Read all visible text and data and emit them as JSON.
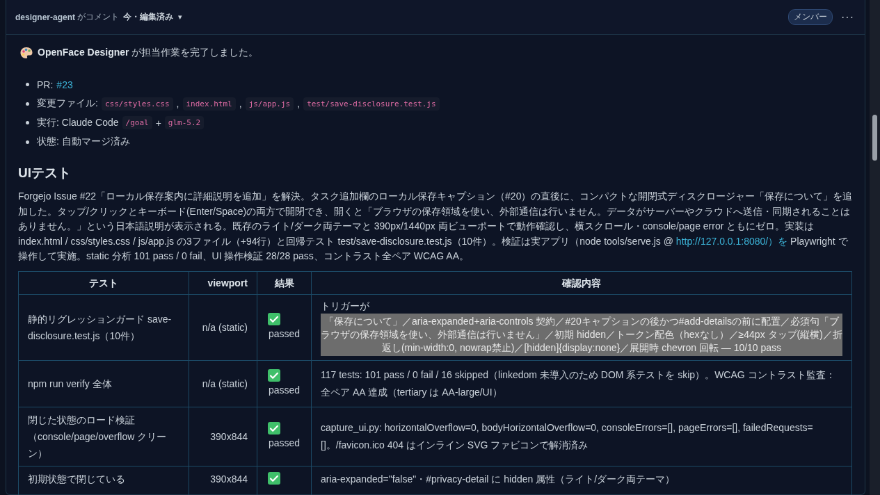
{
  "comment_header": {
    "author": "designer-agent",
    "action": "がコメント",
    "time": "今・編集済み",
    "caret": "▾",
    "badge": "メンバー",
    "more": "···"
  },
  "intro": "**OpenFace Designer** が担当作業を完了しました。",
  "summary": [
    {
      "label": "PR:",
      "parts": [
        {
          "kind": "link",
          "text": "#23"
        }
      ]
    },
    {
      "label": "変更ファイル:",
      "parts": [
        {
          "kind": "code",
          "text": "css/styles.css"
        },
        {
          "kind": "text",
          "text": ","
        },
        {
          "kind": "code",
          "text": "index.html"
        },
        {
          "kind": "text",
          "text": ","
        },
        {
          "kind": "code",
          "text": "js/app.js"
        },
        {
          "kind": "text",
          "text": ","
        },
        {
          "kind": "code",
          "text": "test/save-disclosure.test.js"
        }
      ]
    },
    {
      "label": "実行: Claude Code",
      "parts": [
        {
          "kind": "code",
          "text": "/goal"
        },
        {
          "kind": "text",
          "text": "+"
        },
        {
          "kind": "code",
          "text": "glm-5.2"
        }
      ]
    },
    {
      "label": "状態: 自動マージ済み"
    }
  ],
  "heading": "UIテスト",
  "paragraph": {
    "before": "Forgejo Issue #22「ローカル保存案内に詳細説明を追加」を解決。タスク追加欄のローカル保存キャプション（#20）の直後に、コンパクトな開閉式ディスクロージャー「保存について」を追加した。タップ/クリックとキーボード(Enter/Space)の両方で開閉でき、開くと「ブラウザの保存領域を使い、外部通信は行いません。データがサーバーやクラウドへ送信・同期されることはありません。」という日本語説明が表示される。既存のライト/ダーク両テーマと 390px/1440px 両ビューポートで動作確認し、横スクロール・console/page error ともにゼロ。実装は index.html / css/styles.css / js/app.js の3ファイル（+94行）と回帰テスト test/save-disclosure.test.js（10件）。検証は実アプリ（node tools/serve.js @ ",
    "link": "http://127.0.0.1:8080/）を",
    "after": " Playwright で操作して実施。static 分析 101 pass / 0 fail、UI 操作検証 28/28 pass、コントラスト全ペア WCAG AA。"
  },
  "table": {
    "columns": [
      "テスト",
      "viewport",
      "結果",
      "確認内容"
    ],
    "rows": [
      {
        "test": "静的リグレッションガード save-disclosure.test.js（10件）",
        "viewport": "n/a (static)",
        "result": {
          "ok": true,
          "label": "passed"
        },
        "detail": {
          "kind": "highlight",
          "lead": "トリガーが",
          "text": "「保存について」／aria-expanded+aria-controls 契約／#20キャプションの後かつ#add-detailsの前に配置／必須句「ブラウザの保存領域を使い、外部通信は行いません」／初期 hidden／トークン配色（hexなし）／≥44px タップ(縦横)／折返し(min-width:0, nowrap禁止)／[hidden]{display:none}／展開時 chevron 回転 — 10/10 pass"
        }
      },
      {
        "test": "npm run verify 全体",
        "viewport": "n/a (static)",
        "result": {
          "ok": true,
          "label": "passed"
        },
        "detail": {
          "kind": "plain",
          "text": "117 tests: 101 pass / 0 fail / 16 skipped（linkedom 未導入のため DOM 系テストを skip）。WCAG コントラスト監査：全ペア AA 達成（tertiary は AA-large/UI）"
        }
      },
      {
        "test": "閉じた状態のロード検証（console/page/overflow クリーン）",
        "viewport": "390x844",
        "result": {
          "ok": true,
          "label": "passed"
        },
        "detail": {
          "kind": "plain",
          "text": "capture_ui.py: horizontalOverflow=0, bodyHorizontalOverflow=0, consoleErrors=[], pageErrors=[], failedRequests=[]。/favicon.ico 404 はインライン SVG ファビコンで解消済み"
        }
      },
      {
        "test": "初期状態で閉じている",
        "viewport": "390x844",
        "result": {
          "ok": true
        },
        "detail": {
          "kind": "plain",
          "text": "aria-expanded=\"false\"・#privacy-detail に hidden 属性（ライト/ダーク両テーマ）"
        }
      }
    ]
  }
}
